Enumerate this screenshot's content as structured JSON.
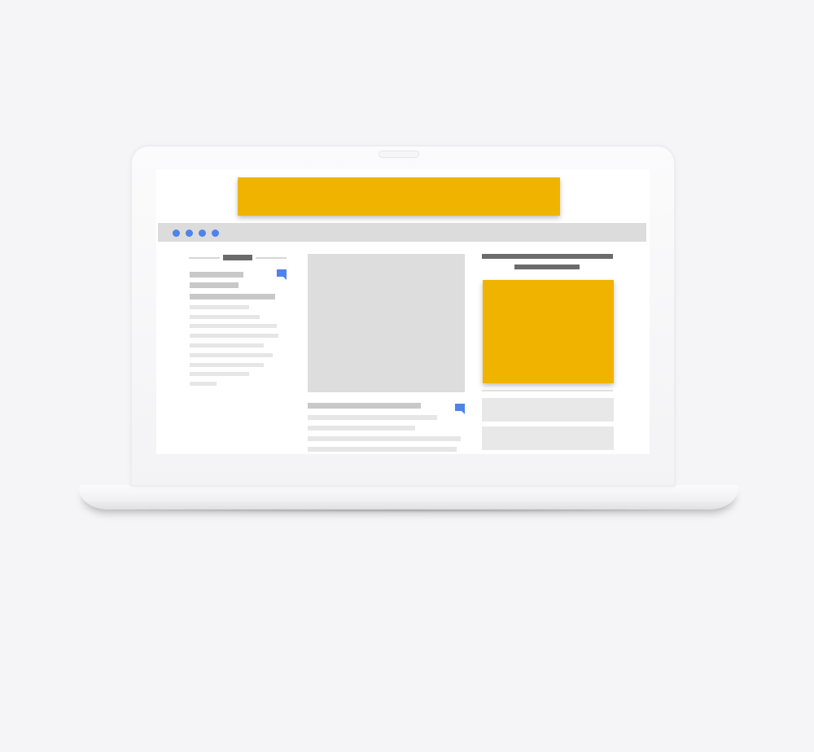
{
  "colors": {
    "background": "#f5f5f7",
    "ad_accent": "#f0b400",
    "nav_dots": "#4f83ec",
    "placeholder_dark": "#6b6b6b",
    "placeholder_mid": "#cccccc",
    "placeholder_light": "#e8e8e8",
    "image_placeholder": "#dddddd"
  },
  "icons": {
    "nav_dots": [
      "dot-icon",
      "dot-icon",
      "dot-icon",
      "dot-icon"
    ],
    "comment": "comment-flag-icon"
  }
}
